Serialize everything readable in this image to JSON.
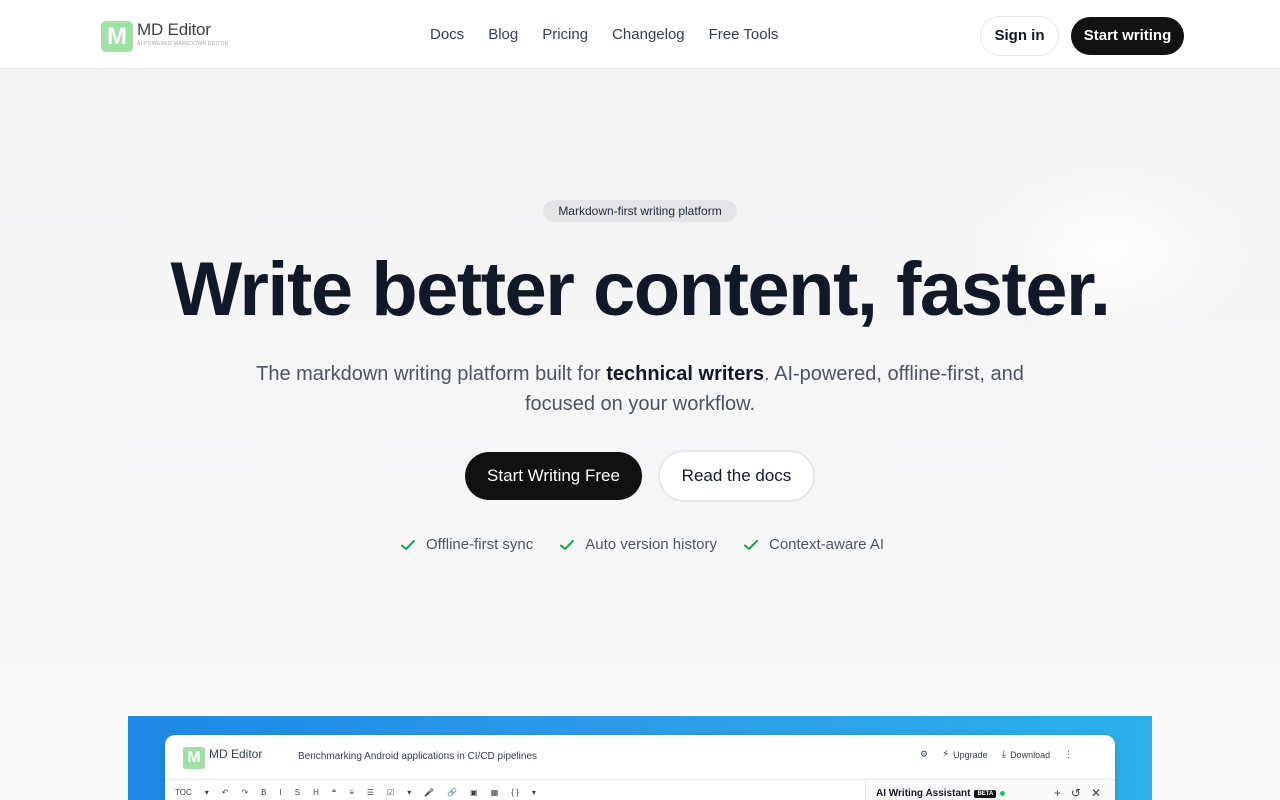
{
  "header": {
    "logo": {
      "name": "MD Editor",
      "tagline": "AI POWERED MARKDOWN EDITOR",
      "mark": "M"
    },
    "nav": [
      "Docs",
      "Blog",
      "Pricing",
      "Changelog",
      "Free Tools"
    ],
    "sign_in": "Sign in",
    "start": "Start writing"
  },
  "hero": {
    "pill": "Markdown-first writing platform",
    "headline": "Write better content, faster.",
    "sub_before": "The markdown writing platform built for ",
    "sub_strong": "technical writers",
    "sub_after": ". AI-powered, offline-first, and focused on your workflow.",
    "cta_primary": "Start Writing Free",
    "cta_secondary": "Read the docs",
    "features": [
      "Offline-first sync",
      "Auto version history",
      "Context-aware AI"
    ]
  },
  "preview": {
    "logo_name": "MD Editor",
    "doc_title": "Benchmarking Android applications in CI/CD pipelines",
    "actions": {
      "upgrade": "Upgrade",
      "download": "Download"
    },
    "toolbar": [
      "TOC",
      "▾",
      "↶",
      "↷",
      "B",
      "I",
      "S",
      "H",
      "❝",
      "≡",
      "☰",
      "☑",
      "▾",
      "🎤",
      "🔗",
      "▣",
      "▦",
      "{ }",
      "▾"
    ],
    "assistant": {
      "title": "AI Writing Assistant",
      "badge": "BETA"
    }
  },
  "colors": {
    "accent": "#111111",
    "check": "#16a34a",
    "logo": "#9ee0a6"
  }
}
